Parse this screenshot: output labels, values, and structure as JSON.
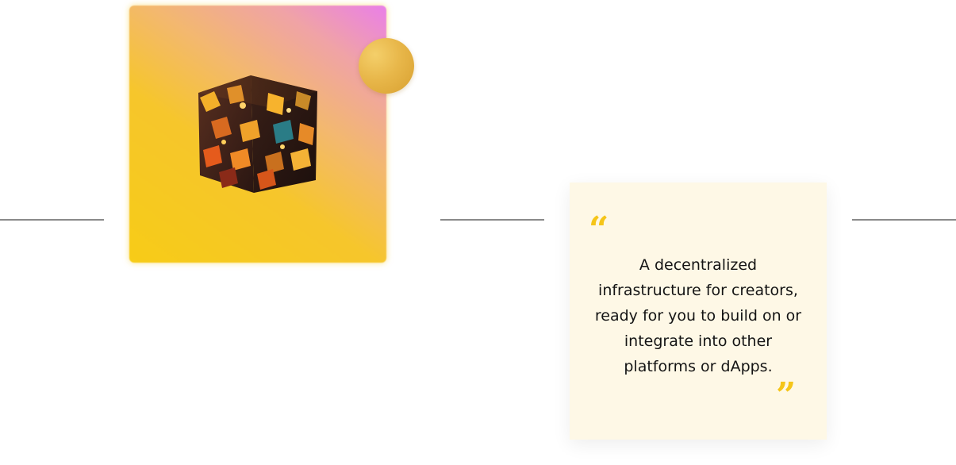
{
  "hero": {
    "art_icon": "crystal-cube",
    "orb_icon": "gold-sphere",
    "gradient_colors": [
      "#f7cc17",
      "#f3b86f",
      "#ea7fe8"
    ]
  },
  "quote": {
    "open_mark": "“",
    "close_mark": "”",
    "text": "A decentralized infrastructure for creators, ready for you to build on or integrate into other platforms or dApps.",
    "accent_color": "#f5c519",
    "card_color": "#fef8e6"
  }
}
